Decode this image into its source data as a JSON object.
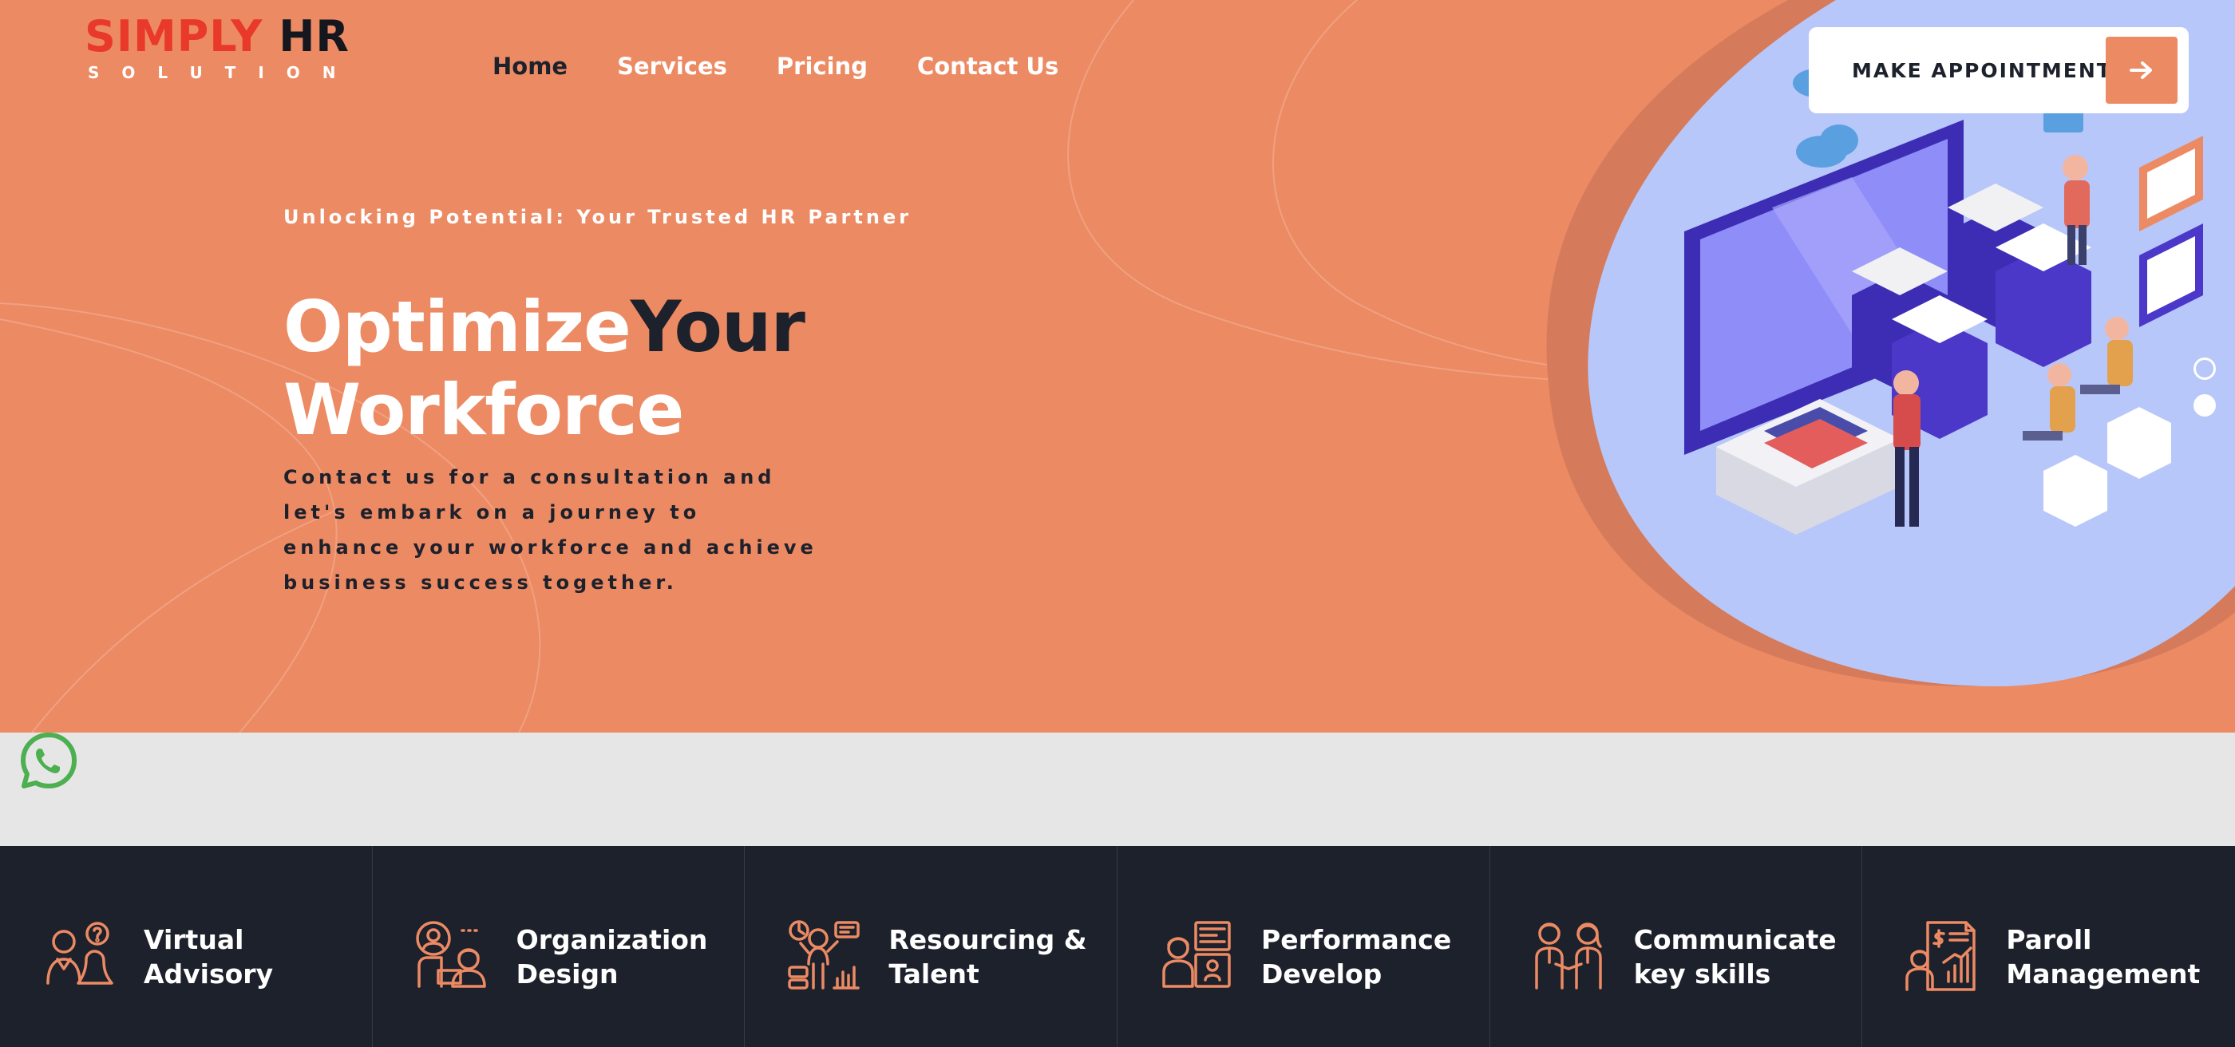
{
  "brand": {
    "name_part1": "SIMPLY",
    "name_part2": "HR",
    "subtitle": "SOLUTION"
  },
  "nav": {
    "items": [
      {
        "label": "Home",
        "active": true
      },
      {
        "label": "Services",
        "active": false
      },
      {
        "label": "Pricing",
        "active": false
      },
      {
        "label": "Contact Us",
        "active": false
      }
    ]
  },
  "cta": {
    "label": "MAKE APPOINTMENT",
    "icon": "arrow-right-icon"
  },
  "hero": {
    "tagline": "Unlocking Potential: Your Trusted HR Partner",
    "headline_word1": "Optimize",
    "headline_word2": "Your",
    "headline_line2": "Workforce",
    "description": "Contact us for a consultation and let's embark on a journey to enhance your workforce and achieve business success together.",
    "slider_dots": 2,
    "active_dot": 2
  },
  "floating": {
    "whatsapp_icon": "whatsapp-icon"
  },
  "services": [
    {
      "line1": "Virtual",
      "line2": "Advisory",
      "icon": "advisory-icon"
    },
    {
      "line1": "Organization",
      "line2": "Design",
      "icon": "organization-icon"
    },
    {
      "line1": "Resourcing &",
      "line2": "Talent",
      "icon": "talent-icon"
    },
    {
      "line1": "Performance",
      "line2": "Develop",
      "icon": "performance-icon"
    },
    {
      "line1": "Communicate",
      "line2": "key skills",
      "icon": "communicate-icon"
    },
    {
      "line1": "Paroll",
      "line2": "Management",
      "icon": "payroll-icon"
    }
  ],
  "colors": {
    "primary": "#ec8a63",
    "dark": "#1d212c",
    "brand_red": "#e8392b",
    "blob": "#b8c7f9",
    "strip": "#e6e6e6",
    "whatsapp": "#4caf50"
  }
}
